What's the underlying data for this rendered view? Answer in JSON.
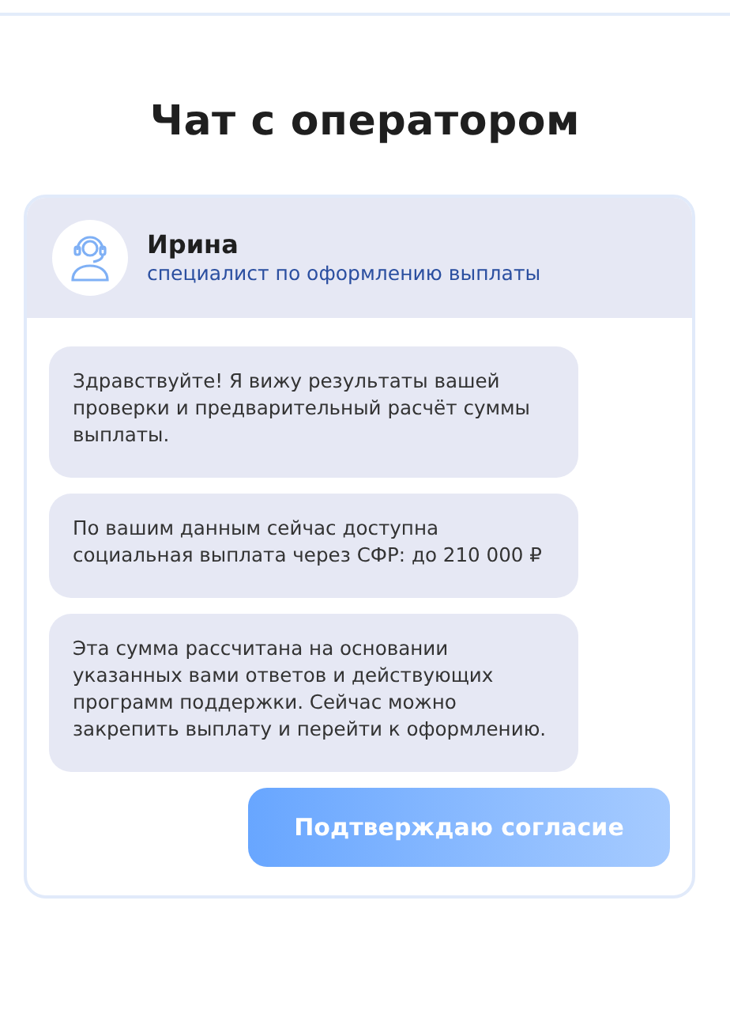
{
  "title": "Чат с оператором",
  "operator": {
    "name": "Ирина",
    "role": "специалист по оформлению выплаты"
  },
  "messages": [
    {
      "text": "Здравствуйте! Я вижу результаты вашей проверки и предварительный расчёт суммы выплаты."
    },
    {
      "text": "По вашим данным сейчас доступна социальная выплата через СФР: до 210 000 ₽"
    },
    {
      "text": "Эта сумма рассчитана на основании указанных вами ответов и действующих программ поддержки. Сейчас можно закрепить выплату и перейти к оформлению."
    }
  ],
  "button": {
    "label": "Подтверждаю согласие"
  }
}
